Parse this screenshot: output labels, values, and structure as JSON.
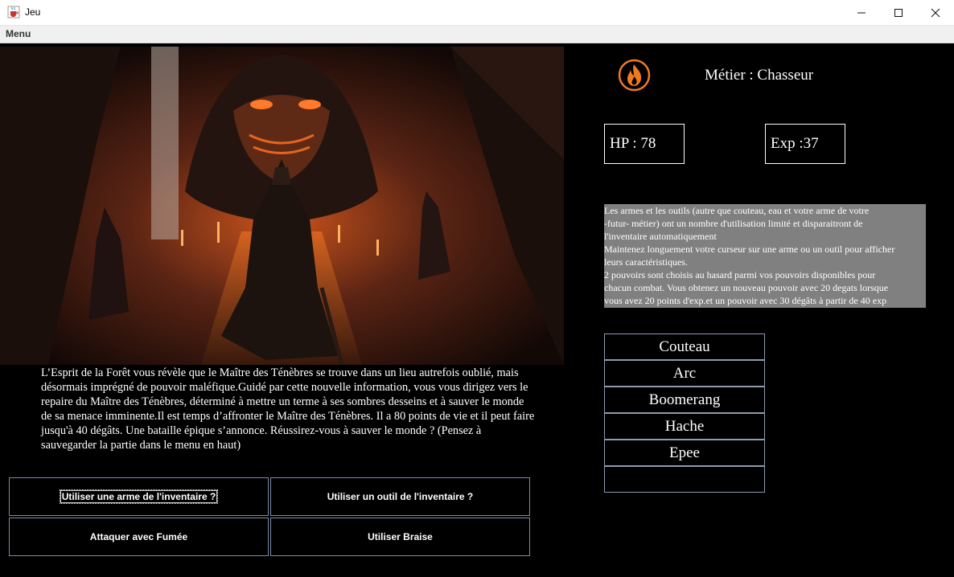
{
  "window": {
    "title": "Jeu"
  },
  "menubar": {
    "menu_label": "Menu"
  },
  "story": {
    "text": "L’Esprit de la Forêt vous révèle que le Maître des Ténèbres se trouve dans un lieu autrefois oublié, mais désormais imprégné de pouvoir maléfique.Guidé par cette nouvelle information, vous vous dirigez vers le repaire du Maître des Ténèbres, déterminé à mettre un terme à ses sombres desseins et à sauver le monde de sa menace imminente.Il est temps d’affronter le Maître des Ténèbres. Il a 80 points de vie et il peut faire jusqu'à 40 dégâts. Une bataille épique s’annonce. Réussirez-vous à sauver le monde ? (Pensez à sauvegarder la partie dans le menu en haut)"
  },
  "actions": {
    "use_weapon": "Utiliser une arme de l'inventaire ?",
    "use_tool": "Utiliser un outil de l'inventaire ?",
    "attack_smoke": "Attaquer avec Fumée",
    "use_ember": "Utiliser Braise"
  },
  "stats": {
    "metier": "Métier : Chasseur",
    "hp": "HP :  78",
    "exp": "Exp :37"
  },
  "info": {
    "lines": [
      "Les armes et les outils (autre que couteau, eau et votre arme de votre",
      "-futur- métier) ont un nombre d'utilisation limité et disparaitront de",
      "l'inventaire automatiquement",
      "Maintenez longuement votre curseur sur une arme ou un outil pour afficher",
      "leurs caractéristiques.",
      "2 pouvoirs sont choisis au hasard parmi vos pouvoirs disponibles pour",
      "chacun combat. Vous obtenez un nouveau pouvoir avec 20 degats lorsque",
      "vous avez 20 points d'exp.et un pouvoir avec 30 dégâts à partir de 40 exp"
    ]
  },
  "inventory": {
    "weapons": [
      "Couteau",
      "Arc",
      "Boomerang",
      "Hache",
      "Epee",
      ""
    ]
  },
  "icons": {
    "app": "java-cup-icon",
    "metier": "fire-icon"
  },
  "colors": {
    "background": "#000000",
    "button_border": "#7b8ca8",
    "info_bg": "#808080",
    "fire": "#f07a1e"
  }
}
